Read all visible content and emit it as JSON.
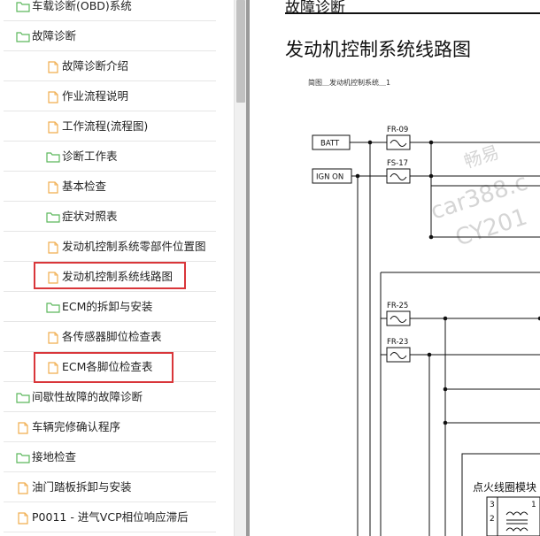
{
  "tree": {
    "items": [
      {
        "label": "车载诊断(OBD)系统",
        "icon": "folder-icon"
      },
      {
        "label": "故障诊断",
        "icon": "folder-icon"
      },
      {
        "label": "故障诊断介绍",
        "icon": "page-icon"
      },
      {
        "label": "作业流程说明",
        "icon": "page-icon"
      },
      {
        "label": "工作流程(流程图)",
        "icon": "page-icon"
      },
      {
        "label": "诊断工作表",
        "icon": "folder-icon"
      },
      {
        "label": "基本检查",
        "icon": "page-icon"
      },
      {
        "label": "症状对照表",
        "icon": "folder-icon"
      },
      {
        "label": "发动机控制系统零部件位置图",
        "icon": "page-icon"
      },
      {
        "label": "发动机控制系统线路图",
        "icon": "page-icon"
      },
      {
        "label": "ECM的拆卸与安装",
        "icon": "folder-icon"
      },
      {
        "label": "各传感器脚位检查表",
        "icon": "page-icon"
      },
      {
        "label": "ECM各脚位检查表",
        "icon": "page-icon"
      },
      {
        "label": "间歇性故障的故障诊断",
        "icon": "folder-icon"
      },
      {
        "label": "车辆完修确认程序",
        "icon": "page-icon"
      },
      {
        "label": "接地检查",
        "icon": "folder-icon"
      },
      {
        "label": "油门踏板拆卸与安装",
        "icon": "page-icon"
      },
      {
        "label": "P0011 - 进气VCP相位响应滞后",
        "icon": "page-icon"
      }
    ]
  },
  "document": {
    "section_header": "故障诊断",
    "title": "发动机控制系统线路图",
    "caption": "简图＿发动机控制系统＿1",
    "watermark": [
      "畅易",
      "car388.c",
      "CY201"
    ],
    "diagram": {
      "boxes": {
        "batt": "BATT",
        "ign_on": "IGN ON"
      },
      "fuses": [
        "FR-09",
        "FS-17",
        "FR-25",
        "FR-23"
      ],
      "module_label": "点火线圈模块",
      "pins": [
        "3",
        "2",
        "1"
      ]
    }
  },
  "colors": {
    "highlight": "#d9363a",
    "folder": "#5cb85c",
    "page": "#f0ad4e"
  }
}
